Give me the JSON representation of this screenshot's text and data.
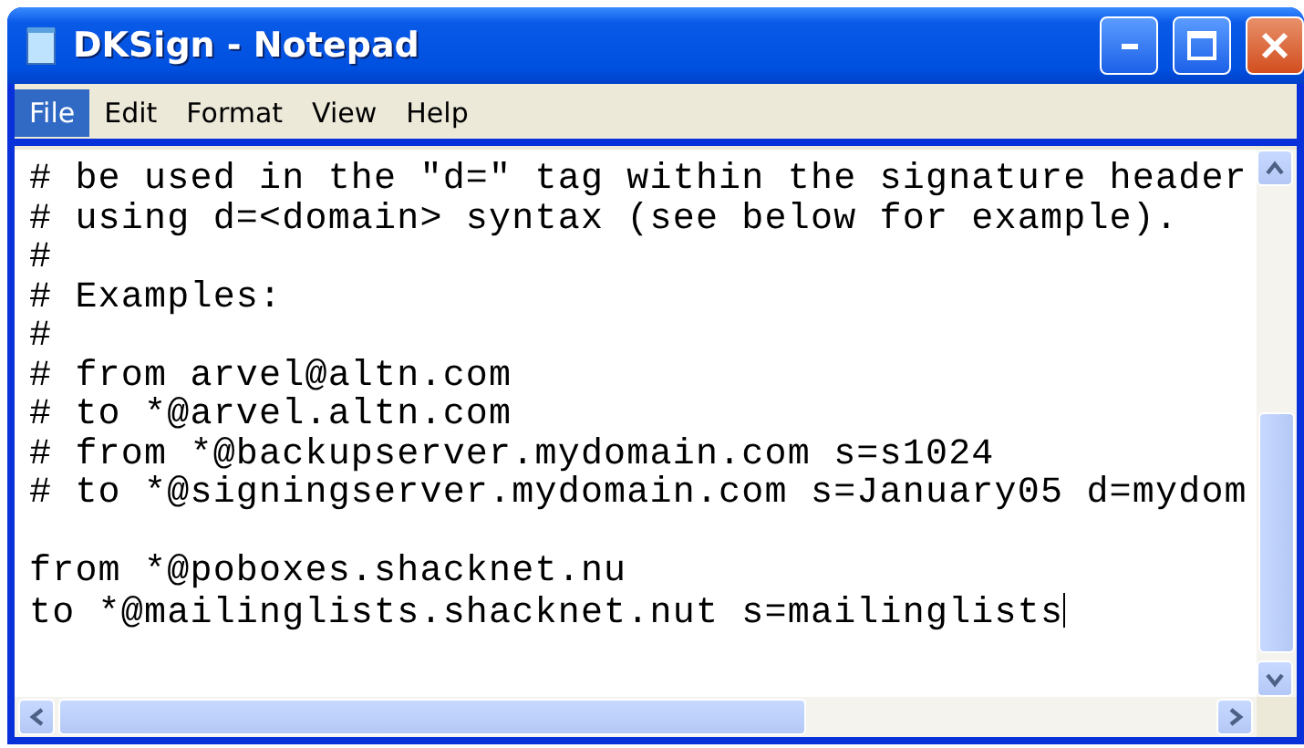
{
  "window": {
    "title": "DKSign - Notepad"
  },
  "menu": [
    {
      "label": "File",
      "selected": true
    },
    {
      "label": "Edit",
      "selected": false
    },
    {
      "label": "Format",
      "selected": false
    },
    {
      "label": "View",
      "selected": false
    },
    {
      "label": "Help",
      "selected": false
    }
  ],
  "editor": {
    "lines": [
      {
        "text": "# be used in the \"d=\" tag within the signature header",
        "caret": false
      },
      {
        "text": "# using d=<domain> syntax (see below for example).",
        "caret": false
      },
      {
        "text": "#",
        "caret": false
      },
      {
        "text": "# Examples:",
        "caret": false
      },
      {
        "text": "#",
        "caret": false
      },
      {
        "text": "# from arvel@altn.com",
        "caret": false
      },
      {
        "text": "# to *@arvel.altn.com",
        "caret": false
      },
      {
        "text": "# from *@backupserver.mydomain.com s=s1024",
        "caret": false
      },
      {
        "text": "# to *@signingserver.mydomain.com s=January05 d=mydom",
        "caret": false
      },
      {
        "caret": false
      },
      {
        "text": "from *@poboxes.shacknet.nu",
        "caret": false
      },
      {
        "text": "to *@mailinglists.shacknet.nut s=mailinglists",
        "caret": true
      }
    ]
  }
}
